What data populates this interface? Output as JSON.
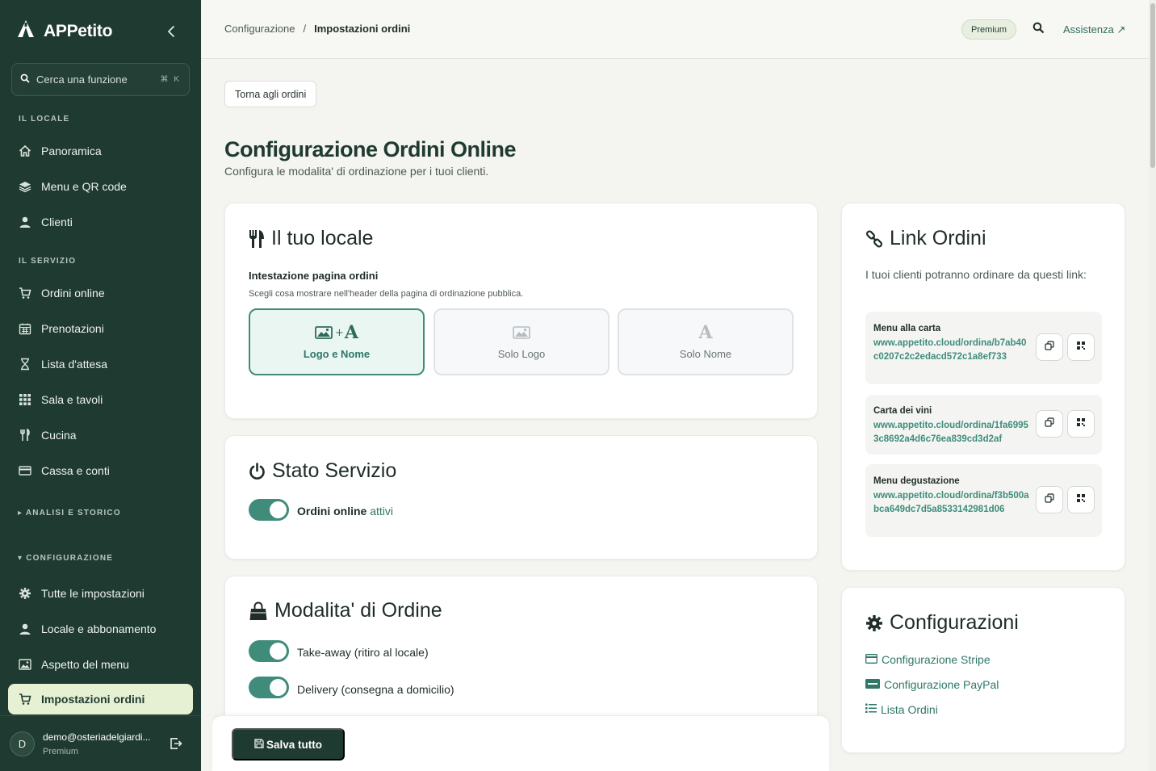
{
  "app": {
    "name": "APPetito"
  },
  "sidebar": {
    "search_placeholder": "Cerca una funzione",
    "search_shortcut": "⌘ K",
    "sections": {
      "locale": "IL LOCALE",
      "servizio": "IL SERVIZIO",
      "analisi": "▸ ANALISI E STORICO",
      "configurazione": "▾ CONFIGURAZIONE"
    },
    "items": [
      {
        "label": "Panoramica",
        "icon": "home-icon"
      },
      {
        "label": "Menu e QR code",
        "icon": "layers-icon"
      },
      {
        "label": "Clienti",
        "icon": "user-icon"
      },
      {
        "label": "Ordini online",
        "icon": "cart-icon"
      },
      {
        "label": "Prenotazioni",
        "icon": "calendar-icon"
      },
      {
        "label": "Lista d'attesa",
        "icon": "hourglass-icon"
      },
      {
        "label": "Sala e tavoli",
        "icon": "grid-icon"
      },
      {
        "label": "Cucina",
        "icon": "utensils-icon"
      },
      {
        "label": "Cassa e conti",
        "icon": "card-icon"
      },
      {
        "label": "Tutte le impostazioni",
        "icon": "gear-icon"
      },
      {
        "label": "Locale e abbonamento",
        "icon": "user-icon"
      },
      {
        "label": "Aspetto del menu",
        "icon": "image-icon"
      },
      {
        "label": "Impostazioni ordini",
        "icon": "cart-icon",
        "active": true
      }
    ],
    "user": {
      "initial": "D",
      "email": "demo@osteriadelgiardi...",
      "plan": "Premium"
    }
  },
  "topbar": {
    "breadcrumb": [
      "Configurazione",
      "/",
      "Impostazioni ordini"
    ],
    "badge": "Premium",
    "help": "Assistenza ↗"
  },
  "main": {
    "back_label": "Torna agli ordini",
    "title": "Configurazione Ordini Online",
    "subtitle": "Configura le modalita' di ordinazione per i tuoi clienti.",
    "locale_card": {
      "title": "Il tuo locale",
      "field_label": "Intestazione pagina ordini",
      "field_hint": "Scegli cosa mostrare nell'header della pagina di ordinazione pubblica.",
      "options": [
        {
          "label": "Logo e Nome",
          "selected": true
        },
        {
          "label": "Solo Logo",
          "selected": false
        },
        {
          "label": "Solo Nome",
          "selected": false
        }
      ]
    },
    "status_card": {
      "title": "Stato Servizio",
      "toggle_label": "Ordini online",
      "toggle_state": "attivi",
      "on": true
    },
    "mode_card": {
      "title": "Modalita' di Ordine",
      "modes": [
        {
          "label": "Take-away (ritiro al locale)",
          "on": true
        },
        {
          "label": "Delivery (consegna a domicilio)",
          "on": true
        }
      ]
    },
    "save_label": "Salva tutto"
  },
  "links_card": {
    "title": "Link Ordini",
    "intro": "I tuoi clienti potranno ordinare da questi link:",
    "links": [
      {
        "name": "Menu alla carta",
        "url": "www.appetito.cloud/ordina/b7ab40c0207c2c2edacd572c1a8ef733"
      },
      {
        "name": "Carta dei vini",
        "url": "www.appetito.cloud/ordina/1fa69953c8692a4d6c76ea839cd3d2af"
      },
      {
        "name": "Menu degustazione",
        "url": "www.appetito.cloud/ordina/f3b500abca649dc7d5a8533142981d06"
      }
    ]
  },
  "config_card": {
    "title": "Configurazioni",
    "links": [
      {
        "label": "Configurazione Stripe",
        "icon": "card-icon"
      },
      {
        "label": "Configurazione PayPal",
        "icon": "paypal-icon"
      },
      {
        "label": "Lista Ordini",
        "icon": "list-icon"
      }
    ]
  },
  "colors": {
    "sidebar_bg": "#1f3a30",
    "accent": "#3f8c7a",
    "active_bg": "#e6f0d3"
  }
}
